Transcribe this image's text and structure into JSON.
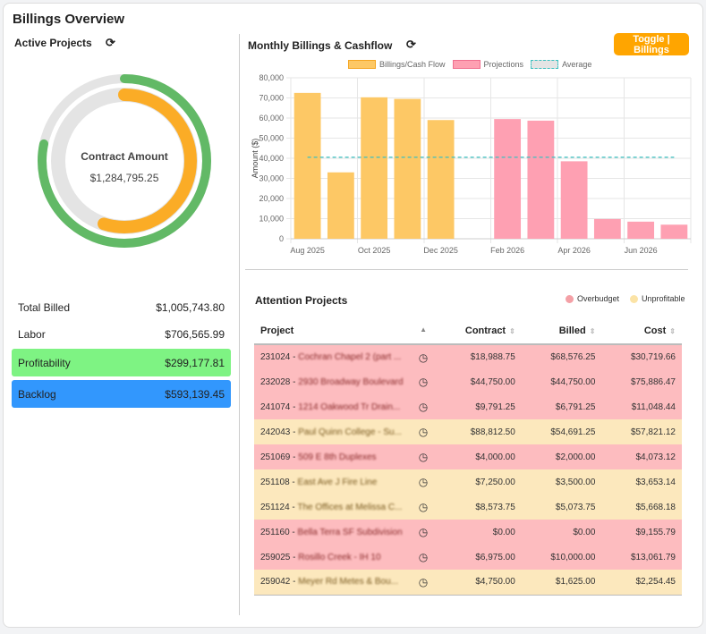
{
  "title": "Billings Overview",
  "active_projects": {
    "label": "Active Projects",
    "center_label": "Contract Amount",
    "center_value": "$1,284,795.25",
    "ring_outer_fraction": 0.783,
    "ring_inner_fraction": 0.55,
    "colors": {
      "outer": "#62b966",
      "inner": "#fbac26",
      "track": "#e4e4e4"
    },
    "stats": [
      {
        "label": "Total Billed",
        "value": "$1,005,743.80"
      },
      {
        "label": "Labor",
        "value": "$706,565.99"
      },
      {
        "label": "Profitability",
        "value": "$299,177.81",
        "color": "#7ef383"
      },
      {
        "label": "Backlog",
        "value": "$593,139.45",
        "color": "#3297fd"
      }
    ]
  },
  "monthly": {
    "label": "Monthly Billings & Cashflow",
    "toggle_label": "Toggle | Billings"
  },
  "chart_data": {
    "type": "bar",
    "ylabel": "Amount ($)",
    "ylim": [
      0,
      80000
    ],
    "yticks": [
      "80,000",
      "70,000",
      "60,000",
      "50,000",
      "40,000",
      "30,000",
      "20,000",
      "10,000",
      "0"
    ],
    "xtick_labels": [
      "Aug 2025",
      "Oct 2025",
      "Dec 2025",
      "Feb 2026",
      "Apr 2026",
      "Jun 2026"
    ],
    "categories": [
      "Aug 2025",
      "Sep 2025",
      "Oct 2025",
      "Nov 2025",
      "Dec 2025",
      "Jan 2026",
      "Feb 2026",
      "Mar 2026",
      "Apr 2026",
      "May 2026",
      "Jun 2026",
      "Jul 2026"
    ],
    "legend": [
      "Billings/Cash Flow",
      "Projections",
      "Average"
    ],
    "series": [
      {
        "name": "Billings/Cash Flow",
        "color": "#fdc865",
        "values": [
          72500,
          33000,
          70300,
          69500,
          59000,
          null,
          null,
          null,
          null,
          null,
          null,
          null
        ]
      },
      {
        "name": "Projections",
        "color": "#fea0b2",
        "values": [
          null,
          null,
          null,
          null,
          null,
          null,
          59500,
          58700,
          38500,
          9800,
          8500,
          7000
        ]
      },
      {
        "name": "Average",
        "color": "#3cc0c0",
        "value": 40500
      }
    ],
    "grid": true,
    "legend_position": "top"
  },
  "attention": {
    "label": "Attention Projects",
    "legend": [
      {
        "label": "Overbudget",
        "color": "#f4a0a6"
      },
      {
        "label": "Unprofitable",
        "color": "#fbe3a6"
      }
    ],
    "columns": [
      "Project",
      "Contract",
      "Billed",
      "Cost"
    ],
    "rows": [
      {
        "id": "231024",
        "name": "Cochran Chapel 2 (part ...",
        "contract": "$18,988.75",
        "billed": "$68,576.25",
        "cost": "$30,719.66",
        "status": "over"
      },
      {
        "id": "232028",
        "name": "2930 Broadway Boulevard",
        "contract": "$44,750.00",
        "billed": "$44,750.00",
        "cost": "$75,886.47",
        "status": "over"
      },
      {
        "id": "241074",
        "name": "1214 Oakwood Tr Drain...",
        "contract": "$9,791.25",
        "billed": "$6,791.25",
        "cost": "$11,048.44",
        "status": "over"
      },
      {
        "id": "242043",
        "name": "Paul Quinn College - Su...",
        "contract": "$88,812.50",
        "billed": "$54,691.25",
        "cost": "$57,821.12",
        "status": "unp"
      },
      {
        "id": "251069",
        "name": "509 E 8th Duplexes",
        "contract": "$4,000.00",
        "billed": "$2,000.00",
        "cost": "$4,073.12",
        "status": "over"
      },
      {
        "id": "251108",
        "name": "East Ave J Fire Line",
        "contract": "$7,250.00",
        "billed": "$3,500.00",
        "cost": "$3,653.14",
        "status": "unp"
      },
      {
        "id": "251124",
        "name": "The Offices at Melissa C...",
        "contract": "$8,573.75",
        "billed": "$5,073.75",
        "cost": "$5,668.18",
        "status": "unp"
      },
      {
        "id": "251160",
        "name": "Bella Terra SF Subdivision",
        "contract": "$0.00",
        "billed": "$0.00",
        "cost": "$9,155.79",
        "status": "over"
      },
      {
        "id": "259025",
        "name": "Rosillo Creek - IH 10",
        "contract": "$6,975.00",
        "billed": "$10,000.00",
        "cost": "$13,061.79",
        "status": "over"
      },
      {
        "id": "259042",
        "name": "Meyer Rd Metes & Bou...",
        "contract": "$4,750.00",
        "billed": "$1,625.00",
        "cost": "$2,254.45",
        "status": "unp"
      }
    ]
  }
}
